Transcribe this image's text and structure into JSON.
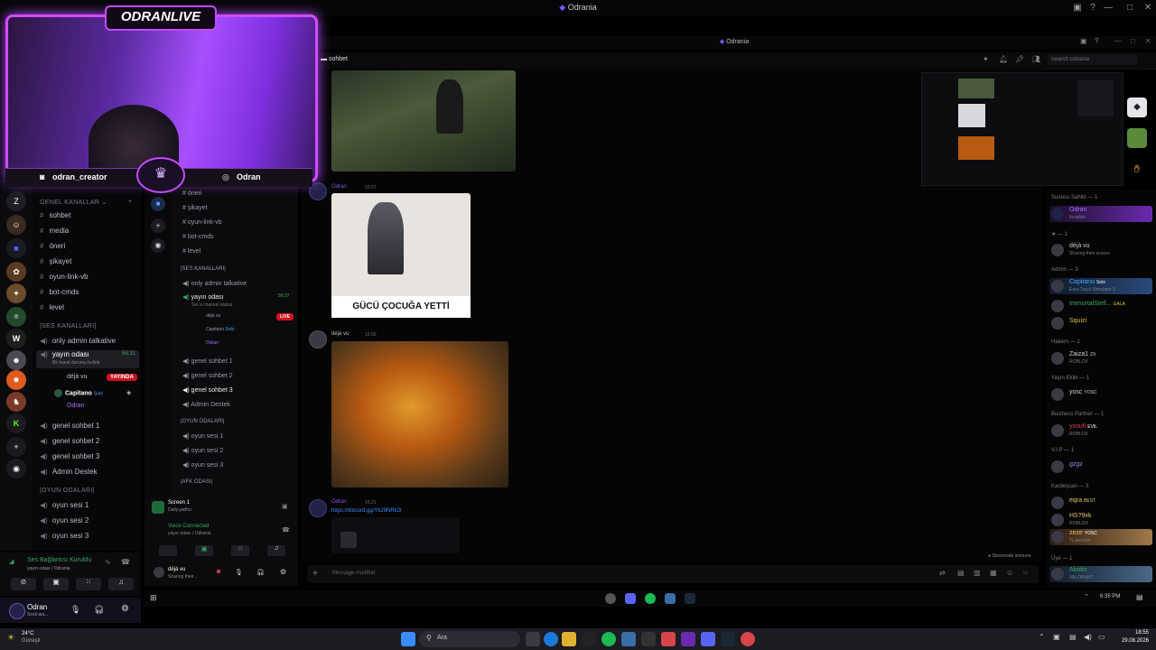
{
  "app": {
    "title": "Odrania",
    "inner_title": "Odrania"
  },
  "overlay": {
    "banner": "ODRANLIVE",
    "discord_handle": "odran_creator",
    "instagram_handle": "Odran"
  },
  "outer_channels": {
    "category_general": "GENEL KANALLAR",
    "text_channels": [
      "sohbet",
      "media",
      "öneri",
      "şikayet",
      "oyun-link-vb",
      "bot-cmds",
      "level"
    ],
    "category_voice": "|SES KANALLARI|",
    "voice_channels": {
      "admin_talkative": "only admin talkative",
      "stream_room": "yayın odası",
      "stream_room_time": "58:31",
      "stream_room_status": "Bir kanal durumu belirle",
      "participants": [
        "déjà vu",
        "Capitano",
        "Odran"
      ],
      "live_badge": "YAYINDA",
      "solo_tag": "Solo",
      "general_voice": [
        "genel sohbet 1",
        "genel sohbet 2",
        "genel sohbet 3"
      ],
      "admin_support": "Admin Destek"
    },
    "category_games": "|OYUN ODALARI|",
    "game_channels": [
      "oyun sesi 1",
      "oyun sesi 2",
      "oyun sesi 3"
    ]
  },
  "outer_voice_panel": {
    "status": "Ses Bağlantısı Kuruldu",
    "location": "yayın odası / Odrania"
  },
  "outer_user": {
    "name": "Odran",
    "status": "Sesli ara..."
  },
  "inner_header": {
    "channel": "sohbet",
    "search_placeholder": "Search Odrania"
  },
  "inner_channels": {
    "text": [
      "öneri",
      "şikayet",
      "oyun-link-vb",
      "bot-cmds",
      "level"
    ],
    "category_voice": "|SES KANALLARI|",
    "admin_talkative": "only admin talkative",
    "stream_room": "yayın odası",
    "stream_room_time": "58:37",
    "stream_room_status": "Set a channel status",
    "participants": [
      "déjà vu",
      "Capitano",
      "Odran"
    ],
    "live_badge": "LIVE",
    "solo_tag": "Solo",
    "general_voice": [
      "genel sohbet 1",
      "genel sohbet 2",
      "genel sohbet 3"
    ],
    "admin_support": "Admin Destek",
    "category_games": "|OYUN ODALARI|",
    "games": [
      "oyun sesi 1",
      "oyun sesi 2",
      "oyun sesi 3"
    ],
    "category_afk": "|AFK ODASI|"
  },
  "inner_voice": {
    "screen_label": "Screen 1",
    "screen_sub": "Daily.yadhu",
    "connected": "Voice Connected",
    "location": "yayın odası / Odrania",
    "user": "déjà vu",
    "user_status": "Sharing their..."
  },
  "chat": {
    "messages": [
      {
        "author": "Odran",
        "time": "15:07",
        "caption": "GÜCÜ ÇOCUĞA YETTİ"
      },
      {
        "author": "déjà vu",
        "time": "16:00"
      },
      {
        "author": "Odran",
        "time": "16:21",
        "link": "https://discord.gg/Yk29NRk2r"
      }
    ],
    "input_placeholder": "Message #sohbet",
    "typing_notice": "Skoemode immune"
  },
  "members": [
    {
      "section": "Sunucu Sahibi",
      "count": "1",
      "users": [
        {
          "name": "Odran",
          "status": "Invisible",
          "color": "#b06bff"
        }
      ]
    },
    {
      "section": "★",
      "count": "1",
      "users": [
        {
          "name": "déjà vu",
          "status": "Sharing their screen",
          "color": "#cfcfd6"
        }
      ]
    },
    {
      "section": "Admin",
      "count": "3",
      "users": [
        {
          "name": "Capitano",
          "status": "Euro Truck Simulator 2",
          "color": "#3ba8ff",
          "tag": "Solo"
        },
        {
          "name": "ImmortalStell...",
          "status": "",
          "color": "#3ba55d",
          "tag": "GALA"
        },
        {
          "name": "Squizi",
          "status": "",
          "color": "#e0c22a"
        }
      ]
    },
    {
      "section": "Hakem",
      "count": "1",
      "users": [
        {
          "name": "Zaiza1",
          "status": "ROBLOX",
          "color": "#cfcfd6",
          "tag": "ZX"
        }
      ]
    },
    {
      "section": "Yayın Ekibi",
      "count": "1",
      "users": [
        {
          "name": "yosc",
          "status": "",
          "color": "#cfcfd6",
          "tag": "YOSC"
        }
      ]
    },
    {
      "section": "Business Partner",
      "count": "1",
      "users": [
        {
          "name": "yosufi",
          "status": "ROBLOX",
          "color": "#d7454b",
          "tag": "EVIL"
        }
      ]
    },
    {
      "section": "V.I.P",
      "count": "1",
      "users": [
        {
          "name": "gzgz",
          "status": "",
          "color": "#8e8ef0"
        }
      ]
    },
    {
      "section": "Kardeşcan",
      "count": "3",
      "users": [
        {
          "name": "eqra",
          "status": "",
          "color": "#e6c36a",
          "tag": "BEST"
        },
        {
          "name": "HS?9xk",
          "status": "ROBLOX",
          "color": "#e6c36a"
        },
        {
          "name": "zeze",
          "status": "TLauncher",
          "color": "#e6c36a",
          "tag": "YOSC"
        }
      ]
    },
    {
      "section": "Üye",
      "count": "1",
      "users": [
        {
          "name": "Abidin",
          "status": "VALORANT",
          "color": "#3ba55d"
        }
      ]
    }
  ],
  "inner_taskbar": {
    "time": "6:35 PM"
  },
  "taskbar": {
    "weather_temp": "24°C",
    "weather_desc": "Güneşli",
    "search": "Ara",
    "time": "18:55",
    "date": "29.08.2026"
  }
}
